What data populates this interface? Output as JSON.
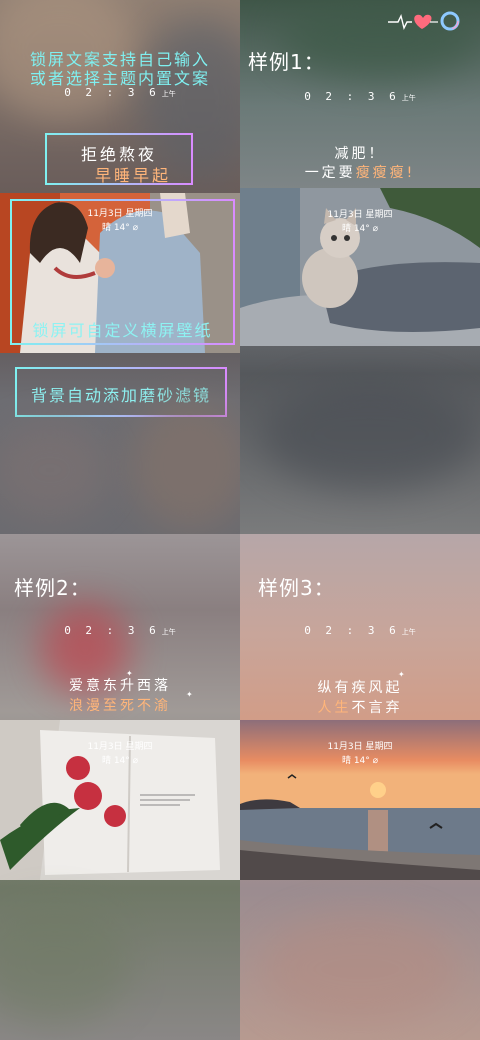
{
  "panel1": {
    "headline_line1": "锁屏文案支持自己输入",
    "headline_line2": "或者选择主题内置文案",
    "time": "0 2 : 3 6",
    "time_ampm": "上午",
    "box1_line1": "拒绝熬夜",
    "box1_line2": "早睡早起",
    "box2_text": "锁屏可自定义横屏壁纸",
    "box3_text": "背景自动添加磨砂滤镜",
    "date_line1": "11月3日 星期四",
    "date_line2": "晴 14° ⌀"
  },
  "panel2": {
    "title": "样例1：",
    "time": "0 2 : 3 6",
    "time_ampm": "上午",
    "quote_line1": "减肥！",
    "quote_line2_prefix": "一定要",
    "quote_line2_emph": "瘦瘦瘦!",
    "date_line1": "11月3日 星期四",
    "date_line2": "晴 14° ⌀"
  },
  "panel3": {
    "title": "样例2：",
    "time": "0 2 : 3 6",
    "time_ampm": "上午",
    "quote_line1": "爱意东升西落",
    "quote_line2": "浪漫至死不渝",
    "date_line1": "11月3日 星期四",
    "date_line2": "晴 14° ⌀"
  },
  "panel4": {
    "title": "样例3：",
    "time": "0 2 : 3 6",
    "time_ampm": "上午",
    "quote_line1": "纵有疾风起",
    "quote_line2_emph": "人生",
    "quote_line2_rest": "不言弃",
    "date_line1": "11月3日 星期四",
    "date_line2": "晴 14° ⌀"
  },
  "icons": {
    "heartbeat": "heartbeat-heart-icon",
    "ring": "ring-icon"
  }
}
